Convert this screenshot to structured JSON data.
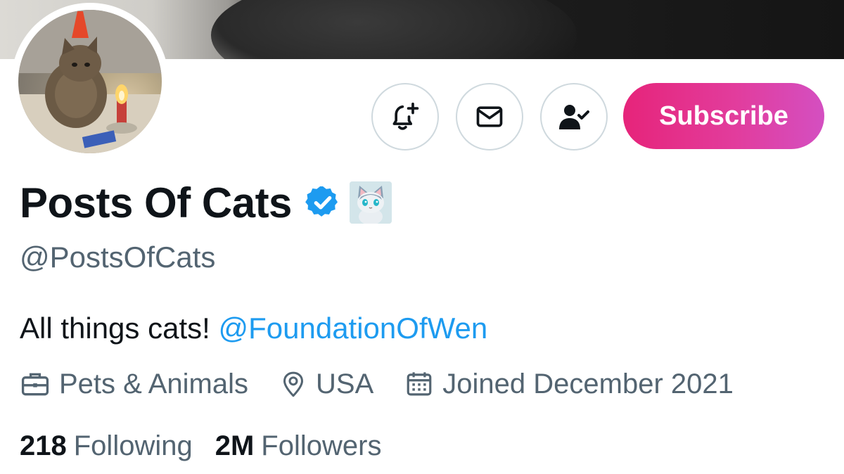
{
  "profile": {
    "display_name": "Posts Of Cats",
    "handle": "@PostsOfCats",
    "bio_text": "All things cats! ",
    "bio_mention": "@FoundationOfWen",
    "category": "Pets & Animals",
    "location": "USA",
    "joined": "Joined December 2021",
    "following_count": "218",
    "following_label": "Following",
    "followers_count": "2M",
    "followers_label": "Followers"
  },
  "actions": {
    "subscribe_label": "Subscribe"
  },
  "icons": {
    "notifications": "bell-plus-icon",
    "message": "envelope-icon",
    "following": "person-check-icon",
    "verified": "verified-badge-icon",
    "category": "briefcase-icon",
    "location": "location-pin-icon",
    "joined": "calendar-icon"
  },
  "colors": {
    "accent_link": "#1d9bf0",
    "verified_blue": "#1d9bf0",
    "subscribe_gradient_start": "#e6247a",
    "subscribe_gradient_end": "#d44fc1",
    "secondary_text": "#536471",
    "primary_text": "#0f1419"
  }
}
